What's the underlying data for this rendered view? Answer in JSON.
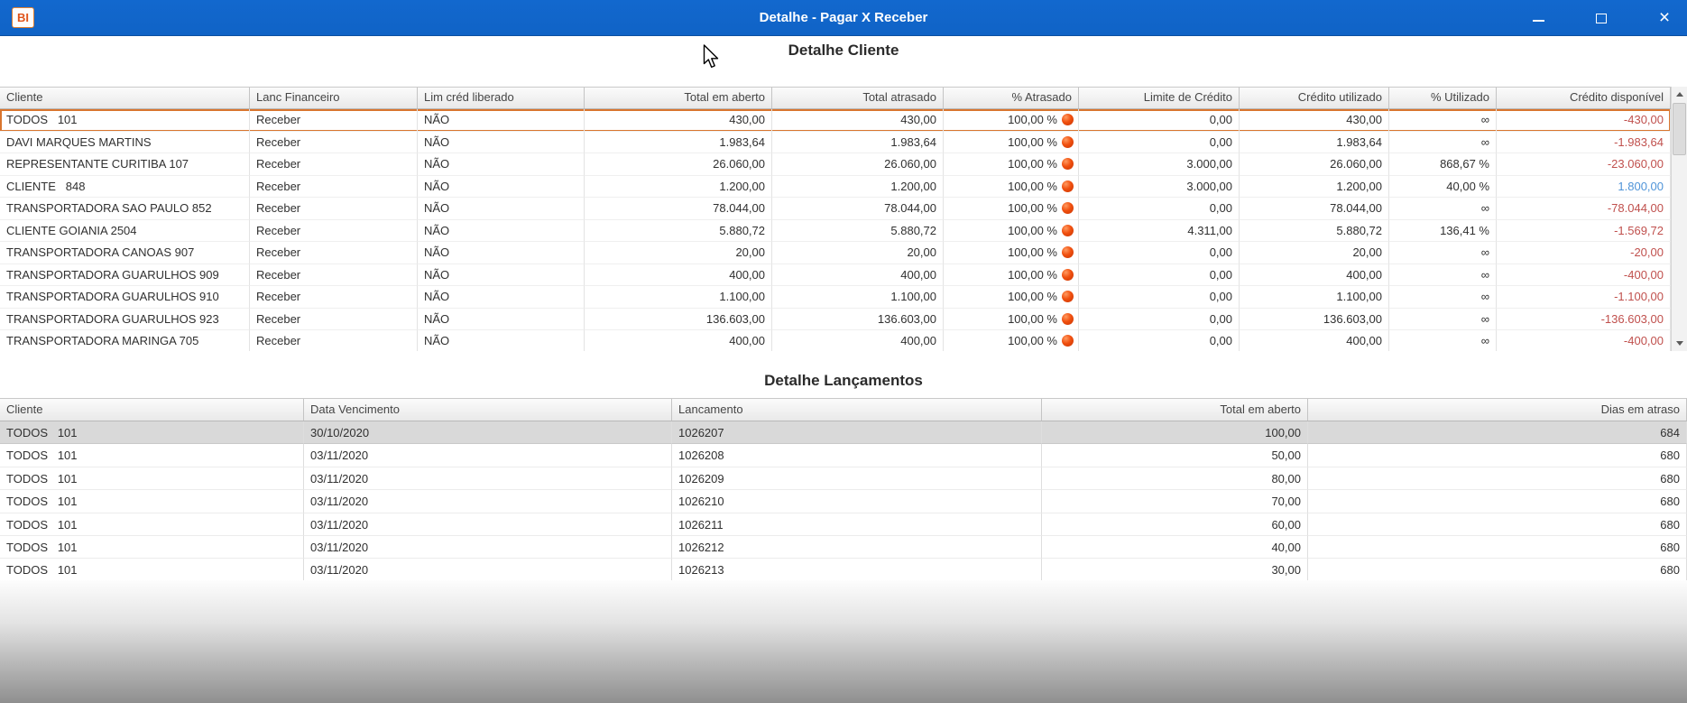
{
  "window": {
    "title": "Detalhe - Pagar X Receber",
    "icon_text": "BI",
    "controls": {
      "close_glyph": "×"
    }
  },
  "colors": {
    "titlebar_blue": "#1166cb",
    "negative_value": "#c0504d",
    "positive_value": "#4f94d8",
    "alert_circle": "#e8400c",
    "selected_row_border": "#d9752e",
    "selected_row2_bg": "#d9d9d9"
  },
  "cliente_table": {
    "title": "Detalhe Cliente",
    "columns": [
      "Cliente",
      "Lanc Financeiro",
      "Lim créd liberado",
      "Total em aberto",
      "Total atrasado",
      "% Atrasado",
      "Limite de Crédito",
      "Crédito utilizado",
      "% Utilizado",
      "Crédito disponível"
    ],
    "rows": [
      {
        "selected": true,
        "cliente": "TODOS   101",
        "lanc_financeiro": "Receber",
        "lim_cred_liberado": "NÃO",
        "total_em_aberto": "430,00",
        "total_atrasado": "430,00",
        "pct_atrasado": "100,00 %",
        "limite_credito": "0,00",
        "credito_utilizado": "430,00",
        "pct_utilizado": "∞",
        "credito_disponivel": "-430,00",
        "disponivel_positive": false
      },
      {
        "selected": false,
        "cliente": "DAVI MARQUES MARTINS",
        "lanc_financeiro": "Receber",
        "lim_cred_liberado": "NÃO",
        "total_em_aberto": "1.983,64",
        "total_atrasado": "1.983,64",
        "pct_atrasado": "100,00 %",
        "limite_credito": "0,00",
        "credito_utilizado": "1.983,64",
        "pct_utilizado": "∞",
        "credito_disponivel": "-1.983,64",
        "disponivel_positive": false
      },
      {
        "selected": false,
        "cliente": "REPRESENTANTE CURITIBA 107",
        "lanc_financeiro": "Receber",
        "lim_cred_liberado": "NÃO",
        "total_em_aberto": "26.060,00",
        "total_atrasado": "26.060,00",
        "pct_atrasado": "100,00 %",
        "limite_credito": "3.000,00",
        "credito_utilizado": "26.060,00",
        "pct_utilizado": "868,67 %",
        "credito_disponivel": "-23.060,00",
        "disponivel_positive": false
      },
      {
        "selected": false,
        "cliente": "CLIENTE   848",
        "lanc_financeiro": "Receber",
        "lim_cred_liberado": "NÃO",
        "total_em_aberto": "1.200,00",
        "total_atrasado": "1.200,00",
        "pct_atrasado": "100,00 %",
        "limite_credito": "3.000,00",
        "credito_utilizado": "1.200,00",
        "pct_utilizado": "40,00 %",
        "credito_disponivel": "1.800,00",
        "disponivel_positive": true
      },
      {
        "selected": false,
        "cliente": "TRANSPORTADORA SAO PAULO 852",
        "lanc_financeiro": "Receber",
        "lim_cred_liberado": "NÃO",
        "total_em_aberto": "78.044,00",
        "total_atrasado": "78.044,00",
        "pct_atrasado": "100,00 %",
        "limite_credito": "0,00",
        "credito_utilizado": "78.044,00",
        "pct_utilizado": "∞",
        "credito_disponivel": "-78.044,00",
        "disponivel_positive": false
      },
      {
        "selected": false,
        "cliente": "CLIENTE GOIANIA 2504",
        "lanc_financeiro": "Receber",
        "lim_cred_liberado": "NÃO",
        "total_em_aberto": "5.880,72",
        "total_atrasado": "5.880,72",
        "pct_atrasado": "100,00 %",
        "limite_credito": "4.311,00",
        "credito_utilizado": "5.880,72",
        "pct_utilizado": "136,41 %",
        "credito_disponivel": "-1.569,72",
        "disponivel_positive": false
      },
      {
        "selected": false,
        "cliente": "TRANSPORTADORA CANOAS 907",
        "lanc_financeiro": "Receber",
        "lim_cred_liberado": "NÃO",
        "total_em_aberto": "20,00",
        "total_atrasado": "20,00",
        "pct_atrasado": "100,00 %",
        "limite_credito": "0,00",
        "credito_utilizado": "20,00",
        "pct_utilizado": "∞",
        "credito_disponivel": "-20,00",
        "disponivel_positive": false
      },
      {
        "selected": false,
        "cliente": "TRANSPORTADORA GUARULHOS 909",
        "lanc_financeiro": "Receber",
        "lim_cred_liberado": "NÃO",
        "total_em_aberto": "400,00",
        "total_atrasado": "400,00",
        "pct_atrasado": "100,00 %",
        "limite_credito": "0,00",
        "credito_utilizado": "400,00",
        "pct_utilizado": "∞",
        "credito_disponivel": "-400,00",
        "disponivel_positive": false
      },
      {
        "selected": false,
        "cliente": "TRANSPORTADORA GUARULHOS 910",
        "lanc_financeiro": "Receber",
        "lim_cred_liberado": "NÃO",
        "total_em_aberto": "1.100,00",
        "total_atrasado": "1.100,00",
        "pct_atrasado": "100,00 %",
        "limite_credito": "0,00",
        "credito_utilizado": "1.100,00",
        "pct_utilizado": "∞",
        "credito_disponivel": "-1.100,00",
        "disponivel_positive": false
      },
      {
        "selected": false,
        "cliente": "TRANSPORTADORA GUARULHOS 923",
        "lanc_financeiro": "Receber",
        "lim_cred_liberado": "NÃO",
        "total_em_aberto": "136.603,00",
        "total_atrasado": "136.603,00",
        "pct_atrasado": "100,00 %",
        "limite_credito": "0,00",
        "credito_utilizado": "136.603,00",
        "pct_utilizado": "∞",
        "credito_disponivel": "-136.603,00",
        "disponivel_positive": false
      },
      {
        "selected": false,
        "cliente": "TRANSPORTADORA MARINGA 705",
        "lanc_financeiro": "Receber",
        "lim_cred_liberado": "NÃO",
        "total_em_aberto": "400,00",
        "total_atrasado": "400,00",
        "pct_atrasado": "100,00 %",
        "limite_credito": "0,00",
        "credito_utilizado": "400,00",
        "pct_utilizado": "∞",
        "credito_disponivel": "-400,00",
        "disponivel_positive": false
      }
    ]
  },
  "lancamentos_table": {
    "title": "Detalhe Lançamentos",
    "columns": [
      "Cliente",
      "Data Vencimento",
      "Lancamento",
      "Total em aberto",
      "Dias em atraso"
    ],
    "rows": [
      {
        "selected": true,
        "cliente": "TODOS   101",
        "data_vencimento": "30/10/2020",
        "lancamento": "1026207",
        "total_em_aberto": "100,00",
        "dias_em_atraso": "684"
      },
      {
        "selected": false,
        "cliente": "TODOS   101",
        "data_vencimento": "03/11/2020",
        "lancamento": "1026208",
        "total_em_aberto": "50,00",
        "dias_em_atraso": "680"
      },
      {
        "selected": false,
        "cliente": "TODOS   101",
        "data_vencimento": "03/11/2020",
        "lancamento": "1026209",
        "total_em_aberto": "80,00",
        "dias_em_atraso": "680"
      },
      {
        "selected": false,
        "cliente": "TODOS   101",
        "data_vencimento": "03/11/2020",
        "lancamento": "1026210",
        "total_em_aberto": "70,00",
        "dias_em_atraso": "680"
      },
      {
        "selected": false,
        "cliente": "TODOS   101",
        "data_vencimento": "03/11/2020",
        "lancamento": "1026211",
        "total_em_aberto": "60,00",
        "dias_em_atraso": "680"
      },
      {
        "selected": false,
        "cliente": "TODOS   101",
        "data_vencimento": "03/11/2020",
        "lancamento": "1026212",
        "total_em_aberto": "40,00",
        "dias_em_atraso": "680"
      },
      {
        "selected": false,
        "cliente": "TODOS   101",
        "data_vencimento": "03/11/2020",
        "lancamento": "1026213",
        "total_em_aberto": "30,00",
        "dias_em_atraso": "680"
      }
    ]
  }
}
